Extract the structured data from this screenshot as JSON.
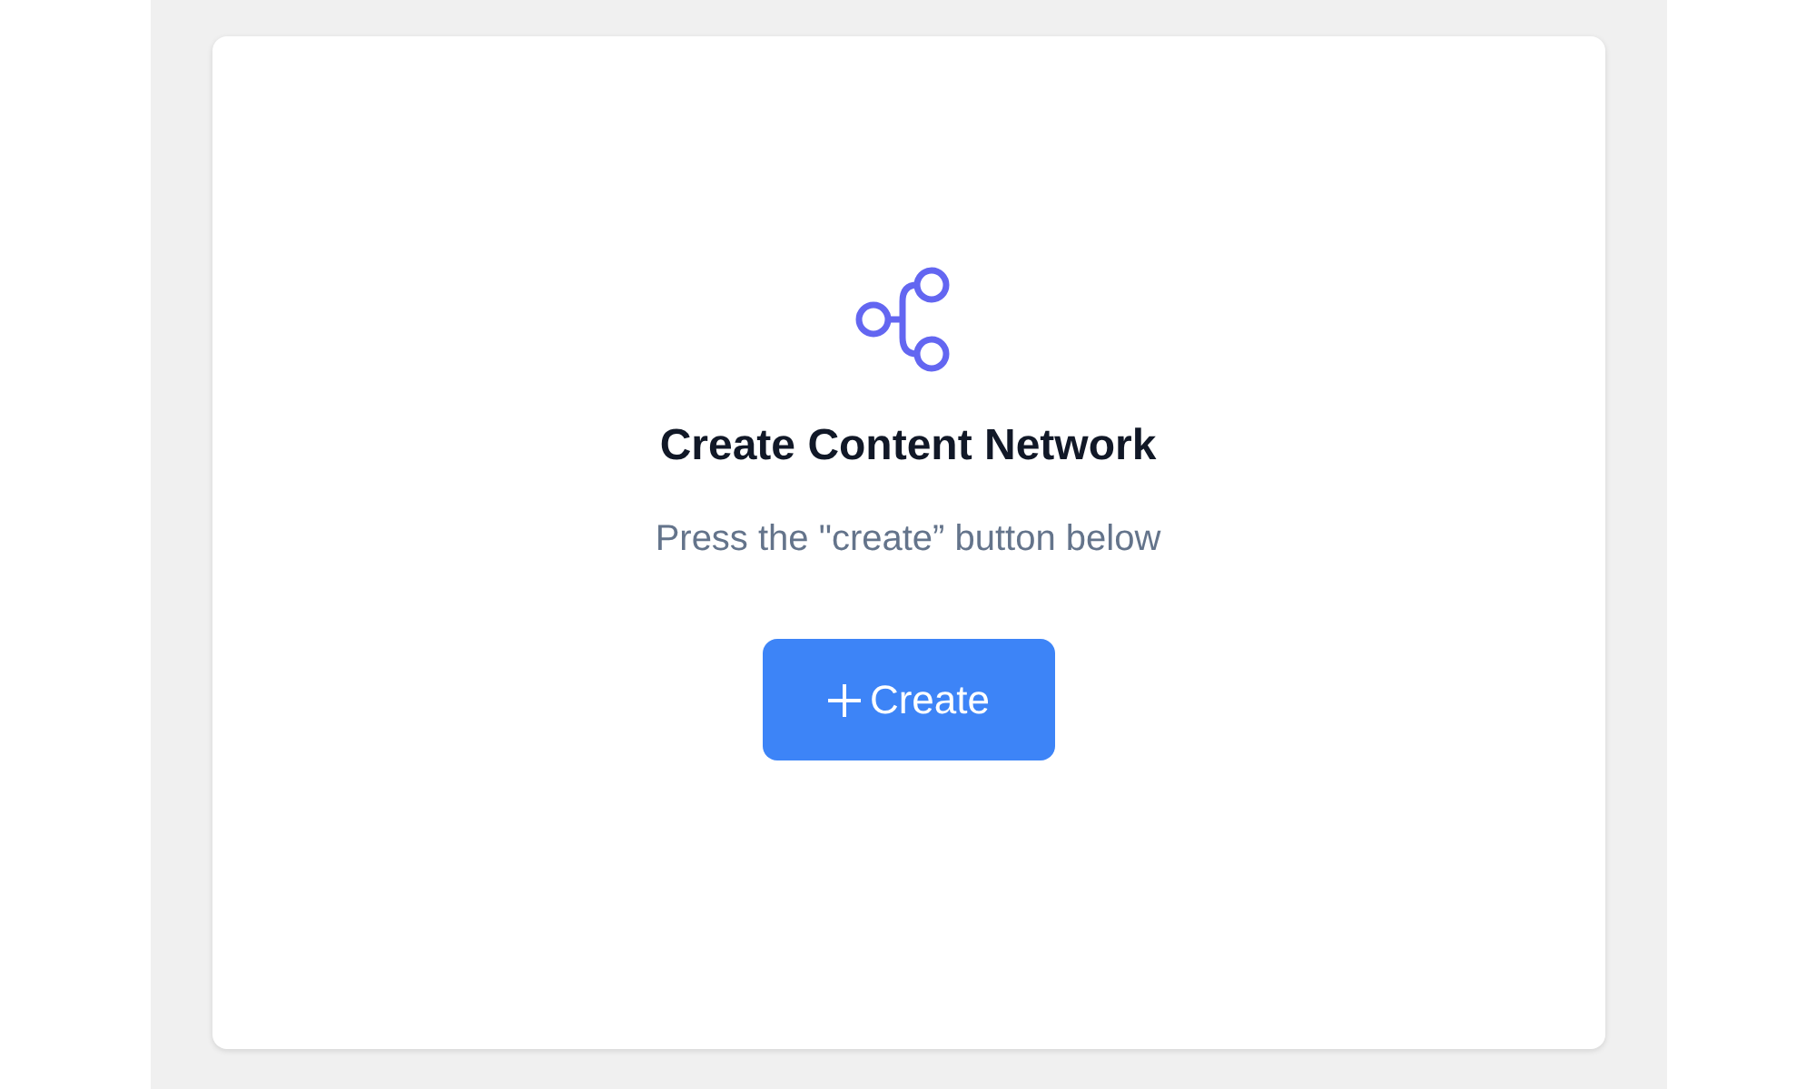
{
  "empty_state": {
    "title": "Create Content Network",
    "subtitle": "Press the \"create” button below",
    "button": {
      "label": "Create"
    }
  }
}
